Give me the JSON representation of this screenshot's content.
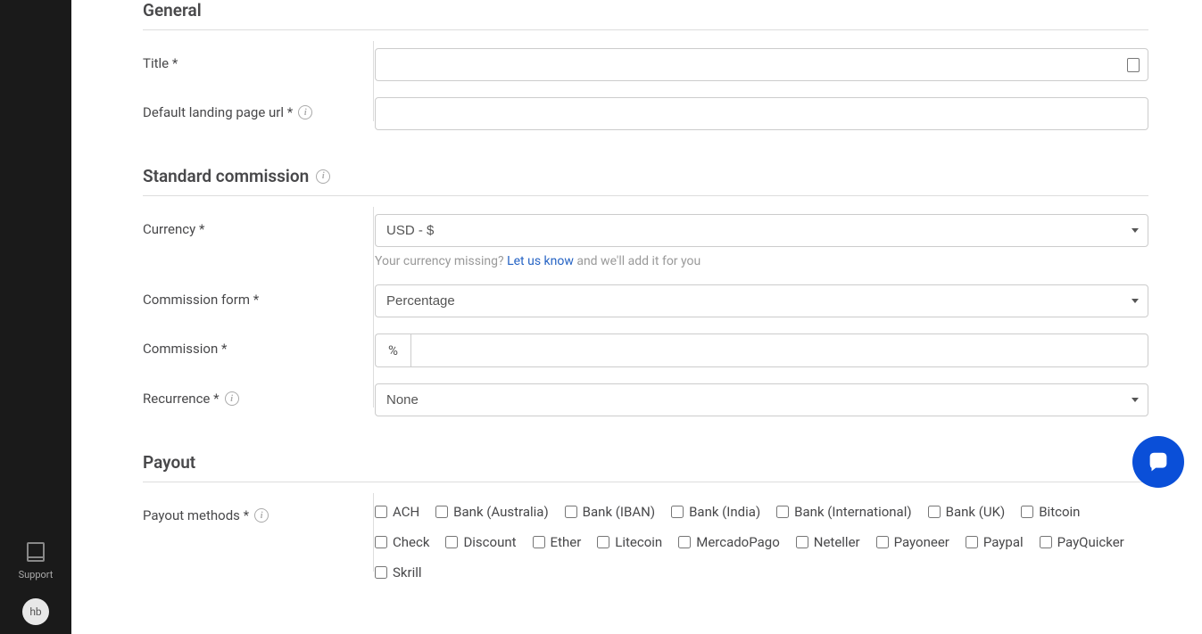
{
  "sidebar": {
    "support_label": "Support",
    "avatar_initials": "hb"
  },
  "sections": {
    "general": {
      "heading": "General",
      "title_label": "Title *",
      "title_value": "",
      "landing_label": "Default landing page url *",
      "landing_value": ""
    },
    "commission": {
      "heading": "Standard commission",
      "currency_label": "Currency *",
      "currency_value": "USD - $",
      "currency_help_prefix": "Your currency missing? ",
      "currency_help_link": "Let us know",
      "currency_help_suffix": " and we'll add it for you",
      "form_label": "Commission form *",
      "form_value": "Percentage",
      "commission_label": "Commission *",
      "commission_addon": "%",
      "commission_value": "",
      "recurrence_label": "Recurrence *",
      "recurrence_value": "None"
    },
    "payout": {
      "heading": "Payout",
      "methods_label": "Payout methods *",
      "methods": [
        "ACH",
        "Bank (Australia)",
        "Bank (IBAN)",
        "Bank (India)",
        "Bank (International)",
        "Bank (UK)",
        "Bitcoin",
        "Check",
        "Discount",
        "Ether",
        "Litecoin",
        "MercadoPago",
        "Neteller",
        "Payoneer",
        "Paypal",
        "PayQuicker",
        "Skrill"
      ]
    }
  }
}
